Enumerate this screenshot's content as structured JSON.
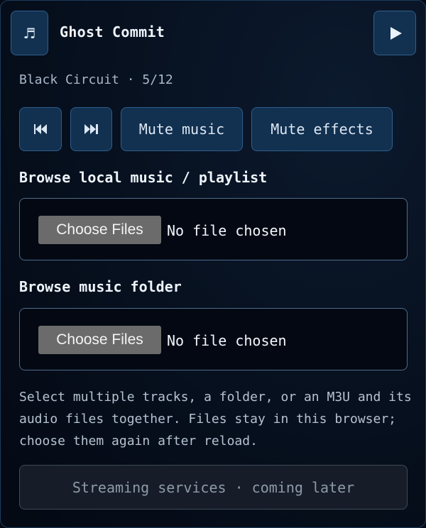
{
  "player": {
    "music_icon": "♬",
    "track_title": "Ghost Commit",
    "subtitle": "Black Circuit · 5/12",
    "play_icon": "play-icon"
  },
  "controls": {
    "prev_icon": "skip-previous-icon",
    "next_icon": "skip-next-icon",
    "mute_music_label": "Mute music",
    "mute_effects_label": "Mute effects"
  },
  "local_music": {
    "label": "Browse local music / playlist",
    "button_label": "Choose Files",
    "status": "No file chosen"
  },
  "music_folder": {
    "label": "Browse music folder",
    "button_label": "Choose Files",
    "status": "No file chosen"
  },
  "hint": "Select multiple tracks, a folder, or an M3U and its audio files together. Files stay in this browser; choose them again after reload.",
  "streaming": {
    "label": "Streaming services · coming later"
  },
  "colors": {
    "button_bg": "#12304f",
    "button_border": "#2e5f8e",
    "file_box_border": "#4d6c8c",
    "choose_button_bg": "#6b6b6b"
  }
}
